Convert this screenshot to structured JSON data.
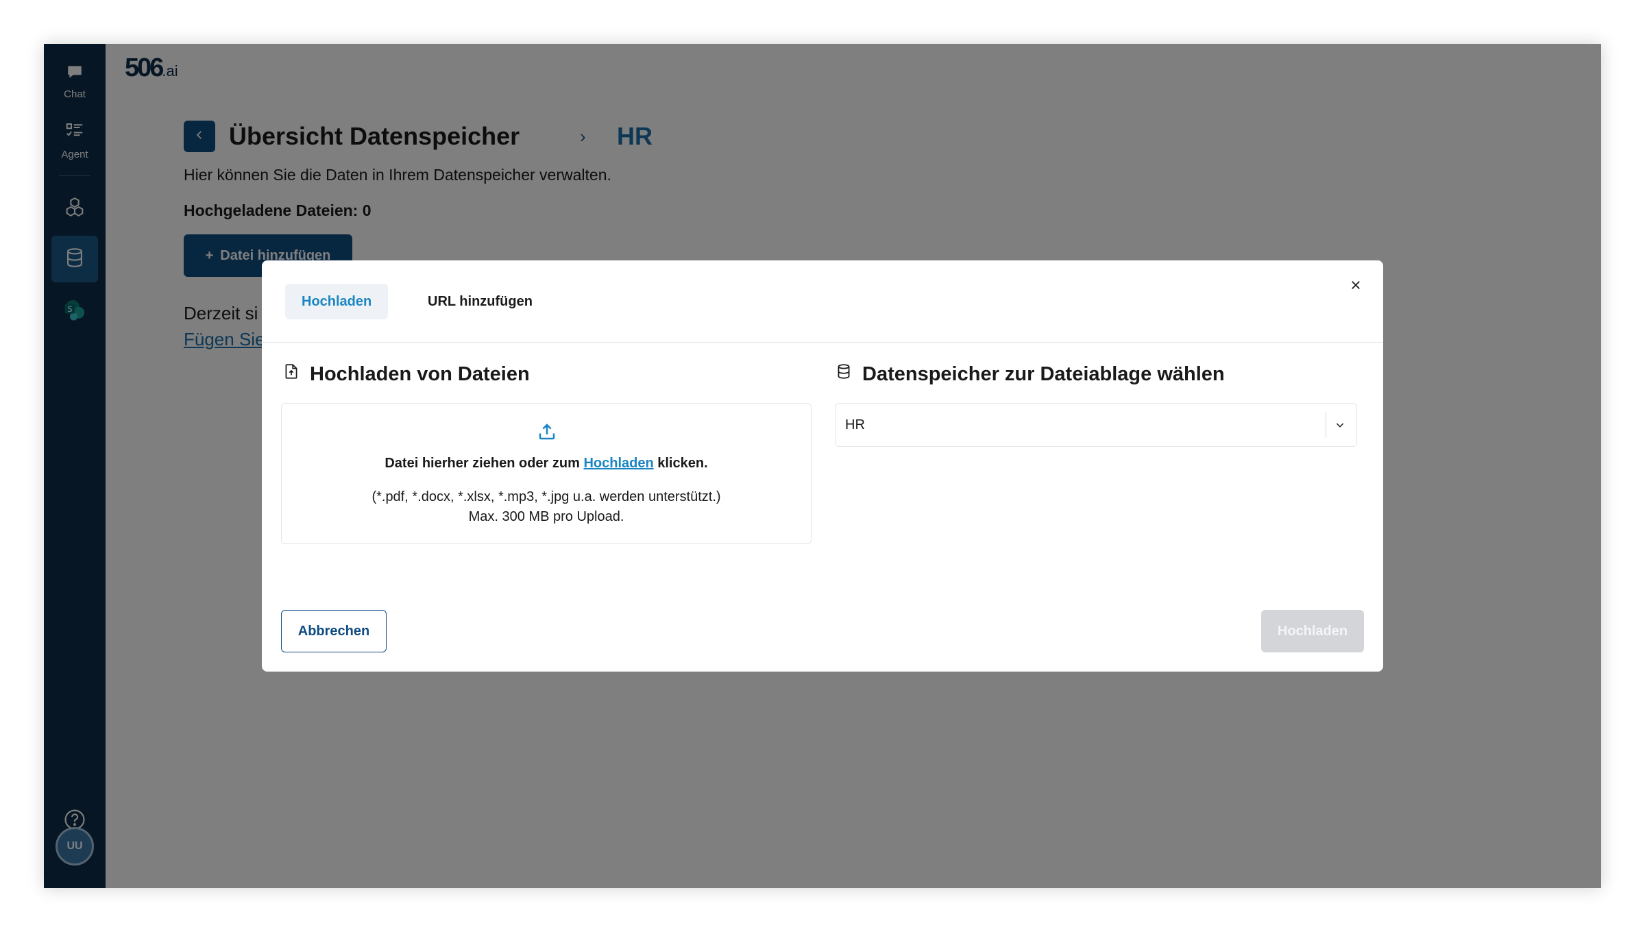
{
  "app": {
    "logo_main": "506",
    "logo_suffix": ".ai"
  },
  "sidebar": {
    "chat_label": "Chat",
    "agent_label": "Agent",
    "avatar_initials": "UU",
    "icons": [
      "chat-icon",
      "agent-list-icon",
      "cubes-icon",
      "database-icon",
      "sharepoint-icon",
      "help-icon"
    ]
  },
  "page": {
    "title": "Übersicht Datenspeicher",
    "breadcrumb_current": "HR",
    "description": "Hier können Sie die Daten in Ihrem Datenspeicher verwalten.",
    "uploaded_count": "Hochgeladene Dateien: 0",
    "add_file_button": "Datei hinzufügen",
    "empty_text": "Derzeit si",
    "empty_link": "Fügen Sie"
  },
  "modal": {
    "tabs": [
      {
        "label": "Hochladen",
        "active": true
      },
      {
        "label": "URL hinzufügen",
        "active": false
      }
    ],
    "upload_title": "Hochladen von Dateien",
    "storage_title": "Datenspeicher zur Dateiablage wählen",
    "dropzone": {
      "text_before": "Datei hierher ziehen oder zum",
      "link": "Hochladen",
      "text_after": "klicken.",
      "formats": "(*.pdf, *.docx, *.xlsx, *.mp3, *.jpg u.a. werden unterstützt.)",
      "max_size": "Max. 300 MB pro Upload."
    },
    "storage_select_value": "HR",
    "cancel_button": "Abbrechen",
    "submit_button": "Hochladen"
  },
  "colors": {
    "sidebar_bg": "#0f2d4a",
    "primary": "#0f4c81",
    "accent": "#1a85c2",
    "disabled_button": "#d3d5d8"
  }
}
